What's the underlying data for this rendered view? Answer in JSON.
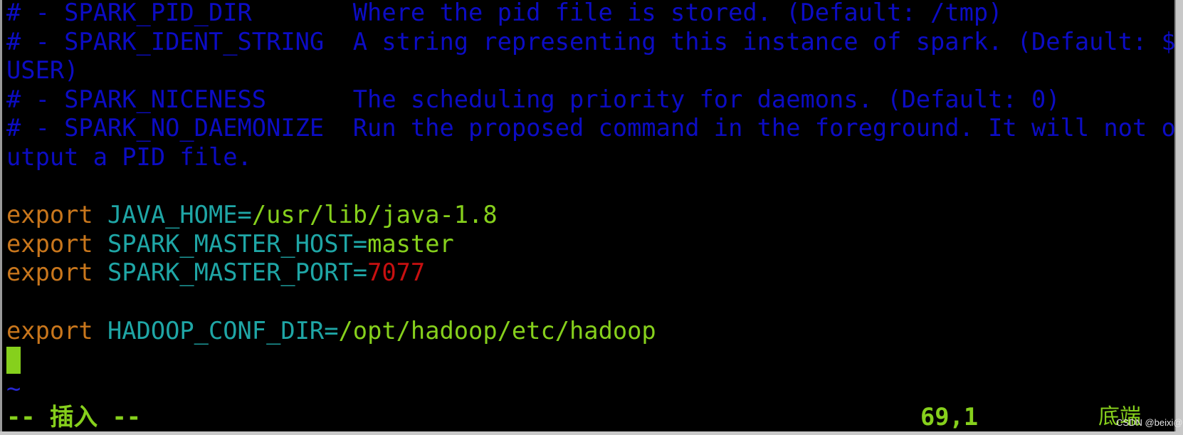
{
  "colors": {
    "comment": "#0c0cc4",
    "keyword": "#c8761c",
    "variable": "#1fa6a6",
    "value": "#86d01c",
    "number": "#c81010",
    "cursor": "#86d01c",
    "status": "#86d01c"
  },
  "lines": [
    {
      "segments": [
        {
          "text": "# - SPARK_PID_DIR       Where the pid file is stored. (Default: /tmp)",
          "cls": "comment"
        }
      ]
    },
    {
      "segments": [
        {
          "text": "# - SPARK_IDENT_STRING  A string representing this instance of spark. (Default: $",
          "cls": "comment"
        }
      ]
    },
    {
      "segments": [
        {
          "text": "USER)",
          "cls": "comment"
        }
      ]
    },
    {
      "segments": [
        {
          "text": "# - SPARK_NICENESS      The scheduling priority for daemons. (Default: 0)",
          "cls": "comment"
        }
      ]
    },
    {
      "segments": [
        {
          "text": "# - SPARK_NO_DAEMONIZE  Run the proposed command in the foreground. It will not o",
          "cls": "comment"
        }
      ]
    },
    {
      "segments": [
        {
          "text": "utput a PID file.",
          "cls": "comment"
        }
      ]
    },
    {
      "segments": []
    },
    {
      "segments": [
        {
          "text": "export ",
          "cls": "keyword"
        },
        {
          "text": "JAVA_HOME=",
          "cls": "var"
        },
        {
          "text": "/usr/lib/java-1.8",
          "cls": "value"
        }
      ]
    },
    {
      "segments": [
        {
          "text": "export ",
          "cls": "keyword"
        },
        {
          "text": "SPARK_MASTER_HOST=",
          "cls": "var"
        },
        {
          "text": "master",
          "cls": "value"
        }
      ]
    },
    {
      "segments": [
        {
          "text": "export ",
          "cls": "keyword"
        },
        {
          "text": "SPARK_MASTER_PORT=",
          "cls": "var"
        },
        {
          "text": "7077",
          "cls": "number"
        }
      ]
    },
    {
      "segments": []
    },
    {
      "segments": [
        {
          "text": "export ",
          "cls": "keyword"
        },
        {
          "text": "HADOOP_CONF_DIR=",
          "cls": "var"
        },
        {
          "text": "/opt/hadoop/etc/hadoop",
          "cls": "value"
        }
      ]
    },
    {
      "segments": []
    },
    {
      "segments": [
        {
          "text": "~",
          "cls": "tilde"
        }
      ]
    }
  ],
  "status": {
    "mode": "-- 插入 --",
    "ruler": "69,1",
    "position": "底端"
  },
  "watermark": "CSDN @beixi@"
}
